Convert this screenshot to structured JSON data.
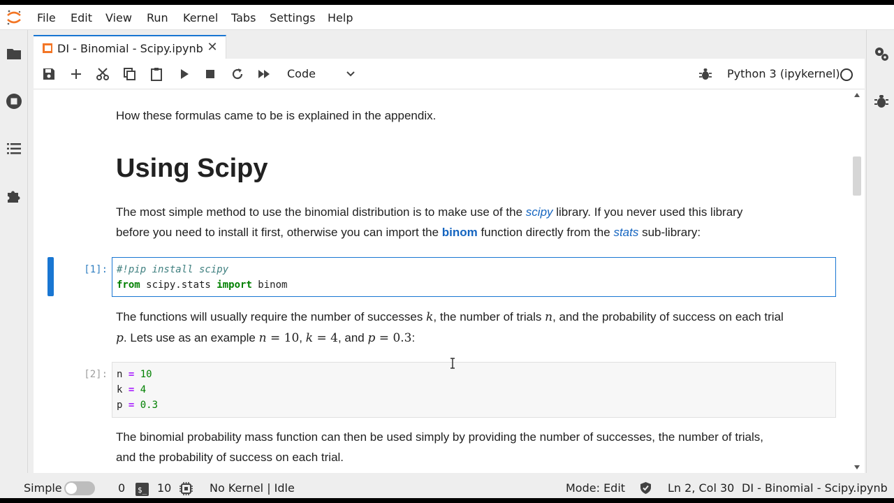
{
  "menu": [
    "File",
    "Edit",
    "View",
    "Run",
    "Kernel",
    "Tabs",
    "Settings",
    "Help"
  ],
  "tab": {
    "title": "DI - Binomial - Scipy.ipynb"
  },
  "toolbar": {
    "cell_type": "Code",
    "kernel_name": "Python 3 (ipykernel)"
  },
  "notebook": {
    "intro_text": "How these formulas came to be is explained in the appendix.",
    "heading": "Using Scipy",
    "md1": {
      "p1": "The most simple method to use the binomial distribution is to make use of the ",
      "link_scipy": "scipy",
      "p2": " library. If you never used this library",
      "p3": "before you need to install it first, otherwise you can import the ",
      "bold_binom": "binom",
      "p4": " function directly from the ",
      "link_stats": "stats",
      "p5": " sub-library:"
    },
    "cell1": {
      "prompt": "[1]:",
      "line1": "#!pip install scipy",
      "kw_from": "from",
      "module": " scipy.stats ",
      "kw_import": "import",
      "name": " binom"
    },
    "md2": {
      "a": "The functions will usually require the number of successes ",
      "k": "k",
      "b": ", the number of trials ",
      "n": "n",
      "c": ", and the probability of success on each trial",
      "p": "p",
      "d": ". Lets use as an example ",
      "m_n": "n",
      "eq": " = ",
      "v_n": "10",
      "comma1": ", ",
      "m_k": "k",
      "v_k": "4",
      "e": ", and ",
      "m_p": "p",
      "v_p": "0.3",
      "f": ":"
    },
    "cell2": {
      "prompt": "[2]:",
      "l1_var": "n",
      "l1_op": "=",
      "l1_val": "10",
      "l2_var": "k",
      "l2_op": "=",
      "l2_val": "4",
      "l3_var": "p",
      "l3_op": "=",
      "l3_val": "0.3"
    },
    "md3": {
      "line1": "The binomial probability mass function can then be used simply by providing the number of successes, the number of trials,",
      "line2": "and the probability of success on each trial."
    }
  },
  "statusbar": {
    "simple_label": "Simple",
    "terminals": "0",
    "kernels": "10",
    "kernel_state": "No Kernel | Idle",
    "mode": "Mode: Edit",
    "position": "Ln 2, Col 30",
    "filename": "DI - Binomial - Scipy.ipynb"
  },
  "colors": {
    "accent": "#1976d2",
    "link": "#1565c0",
    "jupyter_orange": "#f37626"
  }
}
